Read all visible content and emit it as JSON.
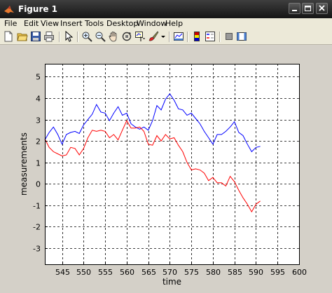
{
  "window": {
    "title": "Figure 1",
    "controls": [
      "minimize-icon",
      "maximize-icon",
      "close-icon"
    ]
  },
  "menu": [
    "File",
    "Edit",
    "View",
    "Insert",
    "Tools",
    "Desktop",
    "Window",
    "Help"
  ],
  "toolbar": {
    "buttons": [
      "new-figure-icon",
      "open-folder-icon",
      "save-icon",
      "print-icon",
      "pointer-icon",
      "zoom-in-icon",
      "zoom-out-icon",
      "pan-hand-icon",
      "rotate-3d-icon",
      "data-cursor-icon",
      "brush-icon",
      "brush-dropdown-icon",
      "link-plot-icon",
      "colorbar-icon",
      "legend-icon",
      "hide-plot-tools-icon",
      "show-plot-tools-icon"
    ]
  },
  "colors": {
    "series_blue": "#0000ff",
    "series_red": "#ff0000",
    "figure_bg": "#d4d0c8"
  },
  "chart_data": {
    "type": "line",
    "xlabel": "time",
    "ylabel": "measurements",
    "xlim": [
      541,
      600
    ],
    "ylim": [
      -3.75,
      5.6
    ],
    "xticks": [
      545,
      550,
      555,
      560,
      565,
      570,
      575,
      580,
      585,
      590,
      595,
      600
    ],
    "yticks": [
      -3,
      -2,
      -1,
      0,
      1,
      2,
      3,
      4,
      5
    ],
    "grid": true,
    "series": [
      {
        "color": "#0000ff",
        "x": [
          541,
          542,
          543,
          544,
          545,
          546,
          547,
          548,
          549,
          550,
          551,
          552,
          553,
          554,
          555,
          556,
          557,
          558,
          559,
          560,
          561,
          562,
          563,
          564,
          565,
          566,
          567,
          568,
          569,
          570,
          571,
          572,
          573,
          574,
          575,
          576,
          577,
          578,
          579,
          580,
          581,
          582,
          583,
          584,
          585,
          586,
          587,
          588,
          589,
          590,
          591
        ],
        "values": [
          2.05,
          2.4,
          2.65,
          2.3,
          1.85,
          2.3,
          2.4,
          2.45,
          2.35,
          2.75,
          3.0,
          3.25,
          3.7,
          3.35,
          3.3,
          2.95,
          3.3,
          3.6,
          3.2,
          3.3,
          2.8,
          2.65,
          2.55,
          2.65,
          2.5,
          2.95,
          3.65,
          3.45,
          3.95,
          4.2,
          3.9,
          3.5,
          3.45,
          3.2,
          3.3,
          3.05,
          2.8,
          2.45,
          2.15,
          1.85,
          2.3,
          2.3,
          2.45,
          2.65,
          2.9,
          2.4,
          2.25,
          1.85,
          1.5,
          1.7,
          1.75
        ]
      },
      {
        "color": "#ff0000",
        "x": [
          541,
          542,
          543,
          544,
          545,
          546,
          547,
          548,
          549,
          550,
          551,
          552,
          553,
          554,
          555,
          556,
          557,
          558,
          559,
          560,
          561,
          562,
          563,
          564,
          565,
          566,
          567,
          568,
          569,
          570,
          571,
          572,
          573,
          574,
          575,
          576,
          577,
          578,
          579,
          580,
          581,
          582,
          583,
          584,
          585,
          586,
          587,
          588,
          589,
          590,
          591
        ],
        "values": [
          2.1,
          1.7,
          1.5,
          1.4,
          1.3,
          1.35,
          1.7,
          1.65,
          1.35,
          1.65,
          2.15,
          2.5,
          2.45,
          2.5,
          2.45,
          2.15,
          2.3,
          2.05,
          2.5,
          2.95,
          2.6,
          2.6,
          2.65,
          2.45,
          1.85,
          1.8,
          2.25,
          2.0,
          2.3,
          2.1,
          2.15,
          1.8,
          1.5,
          1.0,
          0.65,
          0.7,
          0.65,
          0.5,
          0.15,
          0.3,
          0.05,
          0.05,
          -0.1,
          0.35,
          0.1,
          -0.3,
          -0.65,
          -0.95,
          -1.3,
          -0.95,
          -0.8
        ]
      }
    ]
  }
}
